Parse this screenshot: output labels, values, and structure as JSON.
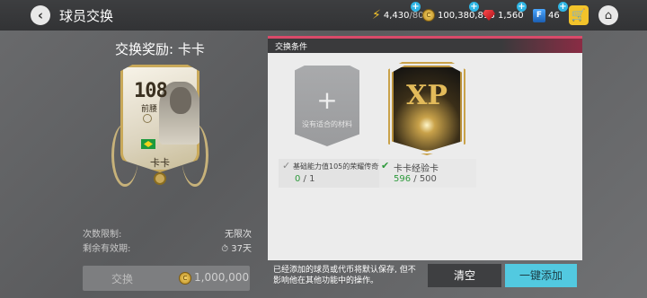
{
  "header": {
    "title": "球员交换",
    "energy": "4,430",
    "energy_max": "/80",
    "coins": "100,380,816",
    "gems": "1,560",
    "points": "46",
    "coin_icon_letter": "C",
    "points_icon_letter": "F"
  },
  "reward": {
    "title": "交换奖励: 卡卡",
    "card": {
      "rating": "108",
      "position": "前腰",
      "name": "卡卡"
    }
  },
  "limits": {
    "count_label": "次数限制:",
    "count_value": "无限次",
    "validity_label": "剩余有效期:",
    "validity_value": "37天"
  },
  "exchange_button": {
    "label": "交换",
    "price": "1,000,000"
  },
  "conditions": {
    "header": "交换条件",
    "empty_slot_text": "没有适合的材料",
    "xp_text": "XP",
    "req1": {
      "label": "基础能力值105的荣耀传奇卡卡",
      "current": "0",
      "total": " / 1"
    },
    "req2": {
      "label": "卡卡经验卡",
      "current": "596",
      "total": " / 500"
    }
  },
  "note": "已经添加的球员或代币将默认保存, 但不影响他在其他功能中的操作。",
  "buttons": {
    "clear": "清空",
    "auto_add": "一键添加"
  },
  "colors": {
    "accent_cyan": "#52c9e0",
    "success_green": "#2e9a3c",
    "panel_accent": "#d94a6a"
  }
}
